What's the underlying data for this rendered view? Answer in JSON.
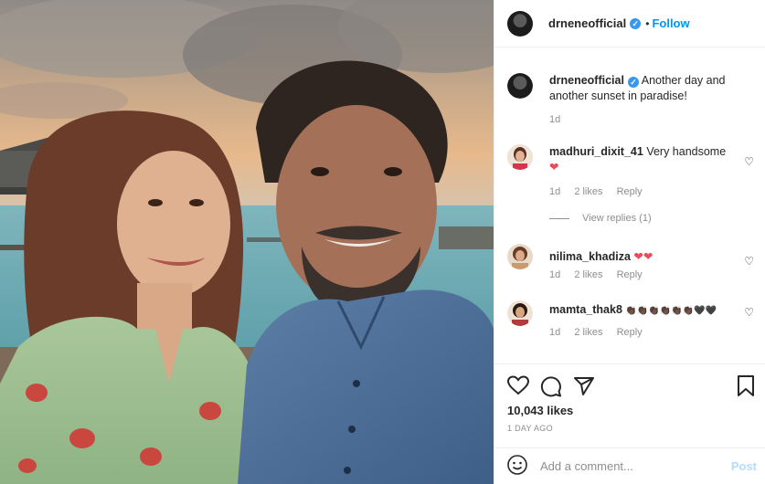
{
  "post_header": {
    "username": "drneneofficial",
    "verified_mark": "✓",
    "separator": "•",
    "follow_label": "Follow"
  },
  "caption": {
    "username": "drneneofficial",
    "text": "Another day and another sunset in paradise!",
    "time": "1d"
  },
  "comments": [
    {
      "username": "madhuri_dixit_41",
      "text": "Very handsome",
      "emoji": "❤",
      "time": "1d",
      "likes": "2 likes",
      "reply": "Reply"
    },
    {
      "username": "nilima_khadiza",
      "text": "",
      "emoji": "❤❤",
      "time": "1d",
      "likes": "2 likes",
      "reply": "Reply"
    },
    {
      "username": "mamta_thak8",
      "text": "",
      "emoji": "👏🏿👏🏿👏🏿👏🏿👏🏿👏🏿🖤🖤",
      "time": "1d",
      "likes": "2 likes",
      "reply": "Reply"
    }
  ],
  "view_replies": "View replies (1)",
  "like_heart": "♡",
  "actions": {
    "icons": [
      "heart-icon",
      "comment-icon",
      "share-icon",
      "bookmark-icon"
    ],
    "likes_count": "10,043 likes",
    "time_ago": "1 DAY AGO"
  },
  "add_comment": {
    "placeholder": "Add a comment...",
    "post_label": "Post"
  },
  "colors": {
    "accent": "#0095f6",
    "verified": "#3897f0",
    "muted": "#8e8e8e",
    "heart": "#ed4956"
  }
}
